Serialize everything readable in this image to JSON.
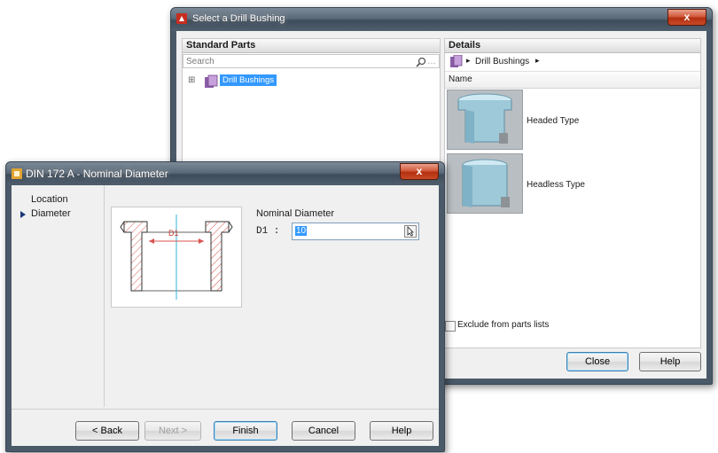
{
  "back_window": {
    "title": "Select a Drill Bushing",
    "close_glyph": "x",
    "left_panel": {
      "header": "Standard Parts",
      "search_placeholder": "Search",
      "tree_expander": "⊞",
      "tree_item": "Drill Bushings"
    },
    "right_panel": {
      "header": "Details",
      "breadcrumb_sep": "▸",
      "breadcrumb_item": "Drill Bushings",
      "column_header": "Name",
      "items": [
        {
          "label": "Headed Type"
        },
        {
          "label": "Headless Type"
        }
      ],
      "exclude_label": "Exclude from parts lists"
    },
    "buttons": {
      "close": "Close",
      "help": "Help"
    }
  },
  "front_window": {
    "title": "DIN 172  A - Nominal Diameter",
    "close_glyph": "x",
    "nav": {
      "location": "Location",
      "diameter": "Diameter"
    },
    "diagram_label": "D1",
    "field_group_label": "Nominal Diameter",
    "d1_label": "D1 :",
    "d1_value": "10",
    "buttons": {
      "back": "< Back",
      "next": "Next >",
      "finish": "Finish",
      "cancel": "Cancel",
      "help": "Help"
    }
  }
}
